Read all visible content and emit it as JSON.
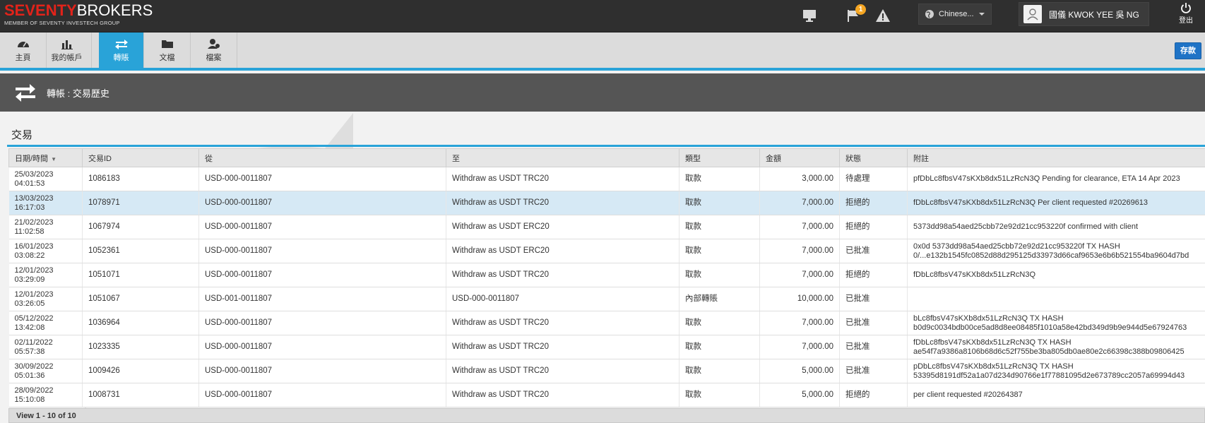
{
  "brand": {
    "logo_red": "SEVENTY",
    "logo_white": "BROKERS",
    "tagline": "MEMBER OF SEVENTY INVESTECH GROUP"
  },
  "topbar": {
    "notification_count": "1",
    "language": "Chinese...",
    "user_name": "國儀 KWOK YEE 吳 NG",
    "logout_label": "登出"
  },
  "nav": {
    "tabs": [
      {
        "label": "主頁",
        "icon": "dashboard-icon"
      },
      {
        "label": "我的帳戶",
        "icon": "bar-chart-icon"
      },
      {
        "label": "轉賬",
        "icon": "transfer-icon"
      },
      {
        "label": "文檔",
        "icon": "folder-icon"
      },
      {
        "label": "檔案",
        "icon": "user-profile-icon"
      }
    ],
    "active": 2,
    "deposit_label": "存款"
  },
  "page": {
    "title": "轉帳 : 交易歷史",
    "section_title": "交易"
  },
  "table": {
    "headers": [
      "日期/時間",
      "交易ID",
      "從",
      "至",
      "類型",
      "金額",
      "狀態",
      "附註"
    ],
    "sorted_column": 0,
    "selected_row": 1,
    "rows": [
      {
        "date": "25/03/2023",
        "time": "04:01:53",
        "id": "1086183",
        "from": "USD-000-0011807",
        "to": "Withdraw as USDT TRC20",
        "type": "取款",
        "amount": "3,000.00",
        "status": "待處理",
        "note1": "pfDbLc8fbsV47sKXb8dx51LzRcN3Q Pending for clearance, ETA 14 Apr 2023",
        "note2": ""
      },
      {
        "date": "13/03/2023",
        "time": "16:17:03",
        "id": "1078971",
        "from": "USD-000-0011807",
        "to": "Withdraw as USDT TRC20",
        "type": "取款",
        "amount": "7,000.00",
        "status": "拒絕的",
        "note1": "fDbLc8fbsV47sKXb8dx51LzRcN3Q Per client requested #20269613",
        "note2": ""
      },
      {
        "date": "21/02/2023",
        "time": "11:02:58",
        "id": "1067974",
        "from": "USD-000-0011807",
        "to": "Withdraw as USDT ERC20",
        "type": "取款",
        "amount": "7,000.00",
        "status": "拒絕的",
        "note1": "5373dd98a54aed25cbb72e92d21cc953220f confirmed with client",
        "note2": ""
      },
      {
        "date": "16/01/2023",
        "time": "03:08:22",
        "id": "1052361",
        "from": "USD-000-0011807",
        "to": "Withdraw as USDT ERC20",
        "type": "取款",
        "amount": "7,000.00",
        "status": "已批准",
        "note1": "0x0d 5373dd98a54aed25cbb72e92d21cc953220f TX HASH",
        "note2": "0/...e132b1545fc0852d88d295125d33973d66caf9653e6b6b521554ba9604d7bd"
      },
      {
        "date": "12/01/2023",
        "time": "03:29:09",
        "id": "1051071",
        "from": "USD-000-0011807",
        "to": "Withdraw as USDT TRC20",
        "type": "取款",
        "amount": "7,000.00",
        "status": "拒絕的",
        "note1": "fDbLc8fbsV47sKXb8dx51LzRcN3Q",
        "note2": ""
      },
      {
        "date": "12/01/2023",
        "time": "03:26:05",
        "id": "1051067",
        "from": "USD-001-0011807",
        "to": "USD-000-0011807",
        "type": "內部轉賬",
        "amount": "10,000.00",
        "status": "已批准",
        "note1": "",
        "note2": ""
      },
      {
        "date": "05/12/2022",
        "time": "13:42:08",
        "id": "1036964",
        "from": "USD-000-0011807",
        "to": "Withdraw as USDT TRC20",
        "type": "取款",
        "amount": "7,000.00",
        "status": "已批准",
        "note1": "bLc8fbsV47sKXb8dx51LzRcN3Q TX HASH",
        "note2": "b0d9c0034bdb00ce5ad8d8ee08485f1010a58e42bd349d9b9e944d5e67924763"
      },
      {
        "date": "02/11/2022",
        "time": "05:57:38",
        "id": "1023335",
        "from": "USD-000-0011807",
        "to": "Withdraw as USDT TRC20",
        "type": "取款",
        "amount": "7,000.00",
        "status": "已批准",
        "note1": "fDbLc8fbsV47sKXb8dx51LzRcN3Q TX HASH",
        "note2": "ae54f7a9386a8106b68d6c52f755be3ba805db0ae80e2c66398c388b09806425"
      },
      {
        "date": "30/09/2022",
        "time": "05:01:36",
        "id": "1009426",
        "from": "USD-000-0011807",
        "to": "Withdraw as USDT TRC20",
        "type": "取款",
        "amount": "5,000.00",
        "status": "已批准",
        "note1": "pDbLc8fbsV47sKXb8dx51LzRcN3Q TX HASH",
        "note2": "53395d8191df52a1a07d234d90766e1f77881095d2e673789cc2057a69994d43"
      },
      {
        "date": "28/09/2022",
        "time": "15:10:08",
        "id": "1008731",
        "from": "USD-000-0011807",
        "to": "Withdraw as USDT TRC20",
        "type": "取款",
        "amount": "5,000.00",
        "status": "拒絕的",
        "note1": "per client requested #20264387",
        "note2": ""
      }
    ]
  },
  "pager": {
    "text": "View 1 - 10 of 10"
  },
  "colors": {
    "accent": "#29a3d8",
    "deposit": "#1f73c6",
    "logo_red": "#e2231a",
    "topbar": "#2f2f2f"
  }
}
